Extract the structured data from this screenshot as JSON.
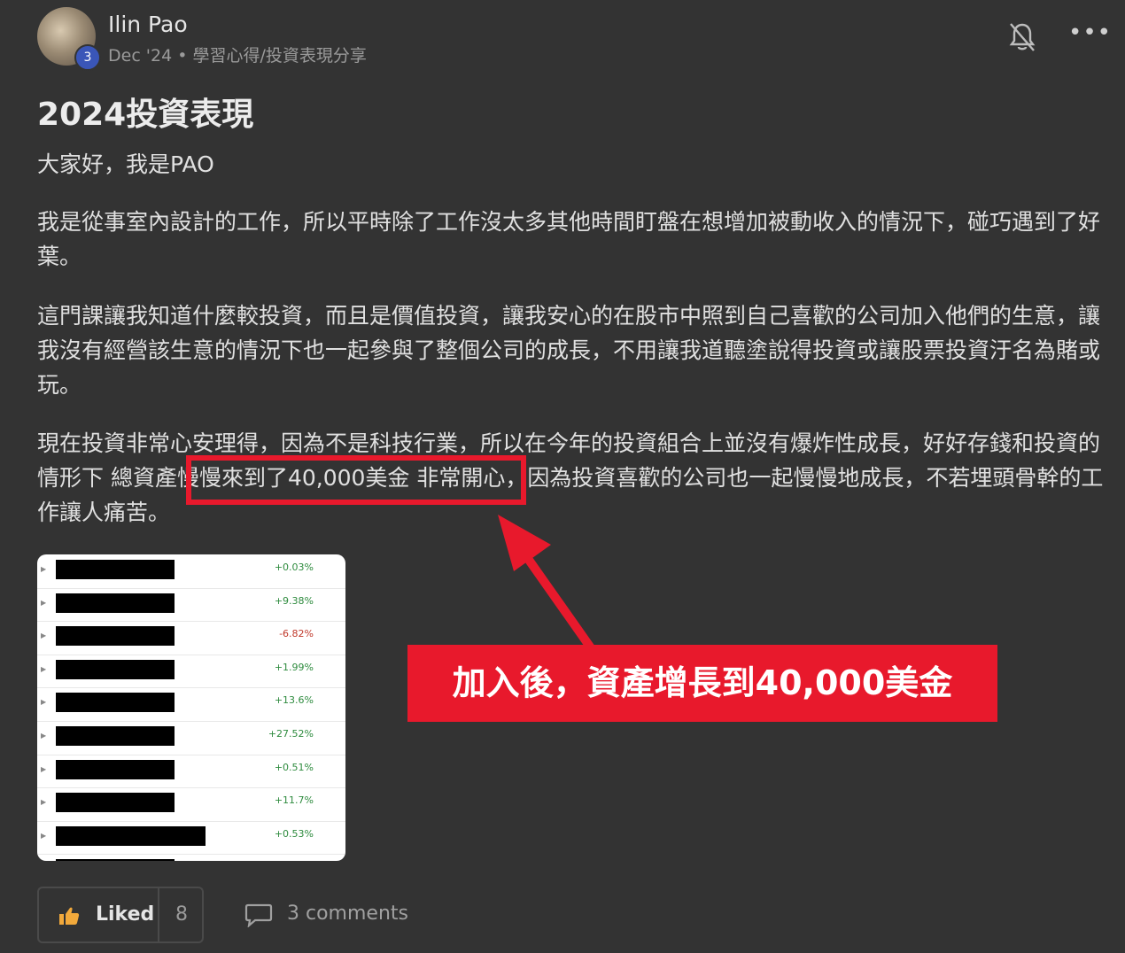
{
  "post": {
    "author": "Ilin Pao",
    "level": "3",
    "meta": "Dec '24 • 學習心得/投資表現分享",
    "title": "2024投資表現",
    "greeting": "大家好，我是PAO",
    "para1": "我是從事室內設計的工作，所以平時除了工作沒太多其他時間盯盤在想增加被動收入的情況下，碰巧遇到了好葉。",
    "para2": "這門課讓我知道什麼較投資，而且是價值投資，讓我安心的在股市中照到自己喜歡的公司加入他們的生意，讓我沒有經營該生意的情況下也一起參與了整個公司的成長，不用讓我道聽塗說得投資或讓股票投資汙名為賭或玩。",
    "para3_a": "現在投資非常心安理得，因為不是科技行業，所以在今年的投資組合上並沒有爆炸性成長，好好存錢和投資的情形下 ",
    "para3_highlight": "總資產慢慢來到了40,000美金",
    "para3_b": " 非常開心，因為投資喜歡的公司也一起慢慢地成長，不若埋頭骨幹的工作讓人痛苦。"
  },
  "annotation": {
    "callout": "加入後，資產增長到40,000美金",
    "color": "#e8192c"
  },
  "portfolio_image": {
    "rows": [
      {
        "pct": "+0.03%",
        "sign": "pos"
      },
      {
        "pct": "+9.38%",
        "sign": "pos"
      },
      {
        "pct": "-6.82%",
        "sign": "neg"
      },
      {
        "pct": "+1.99%",
        "sign": "pos"
      },
      {
        "pct": "+13.6%",
        "sign": "pos"
      },
      {
        "pct": "+27.52%",
        "sign": "pos"
      },
      {
        "pct": "+0.51%",
        "sign": "pos"
      },
      {
        "pct": "+11.7%",
        "sign": "pos"
      },
      {
        "pct": "+0.53%",
        "sign": "pos"
      },
      {
        "pct": "",
        "sign": "pos"
      }
    ]
  },
  "actions": {
    "like_label": "Liked",
    "like_count": "8",
    "comments_label": "3 comments"
  },
  "icons": {
    "notify": "bell-off-icon",
    "more": "more-horizontal-icon",
    "like": "thumbs-up-icon",
    "comment": "comment-bubble-icon"
  }
}
